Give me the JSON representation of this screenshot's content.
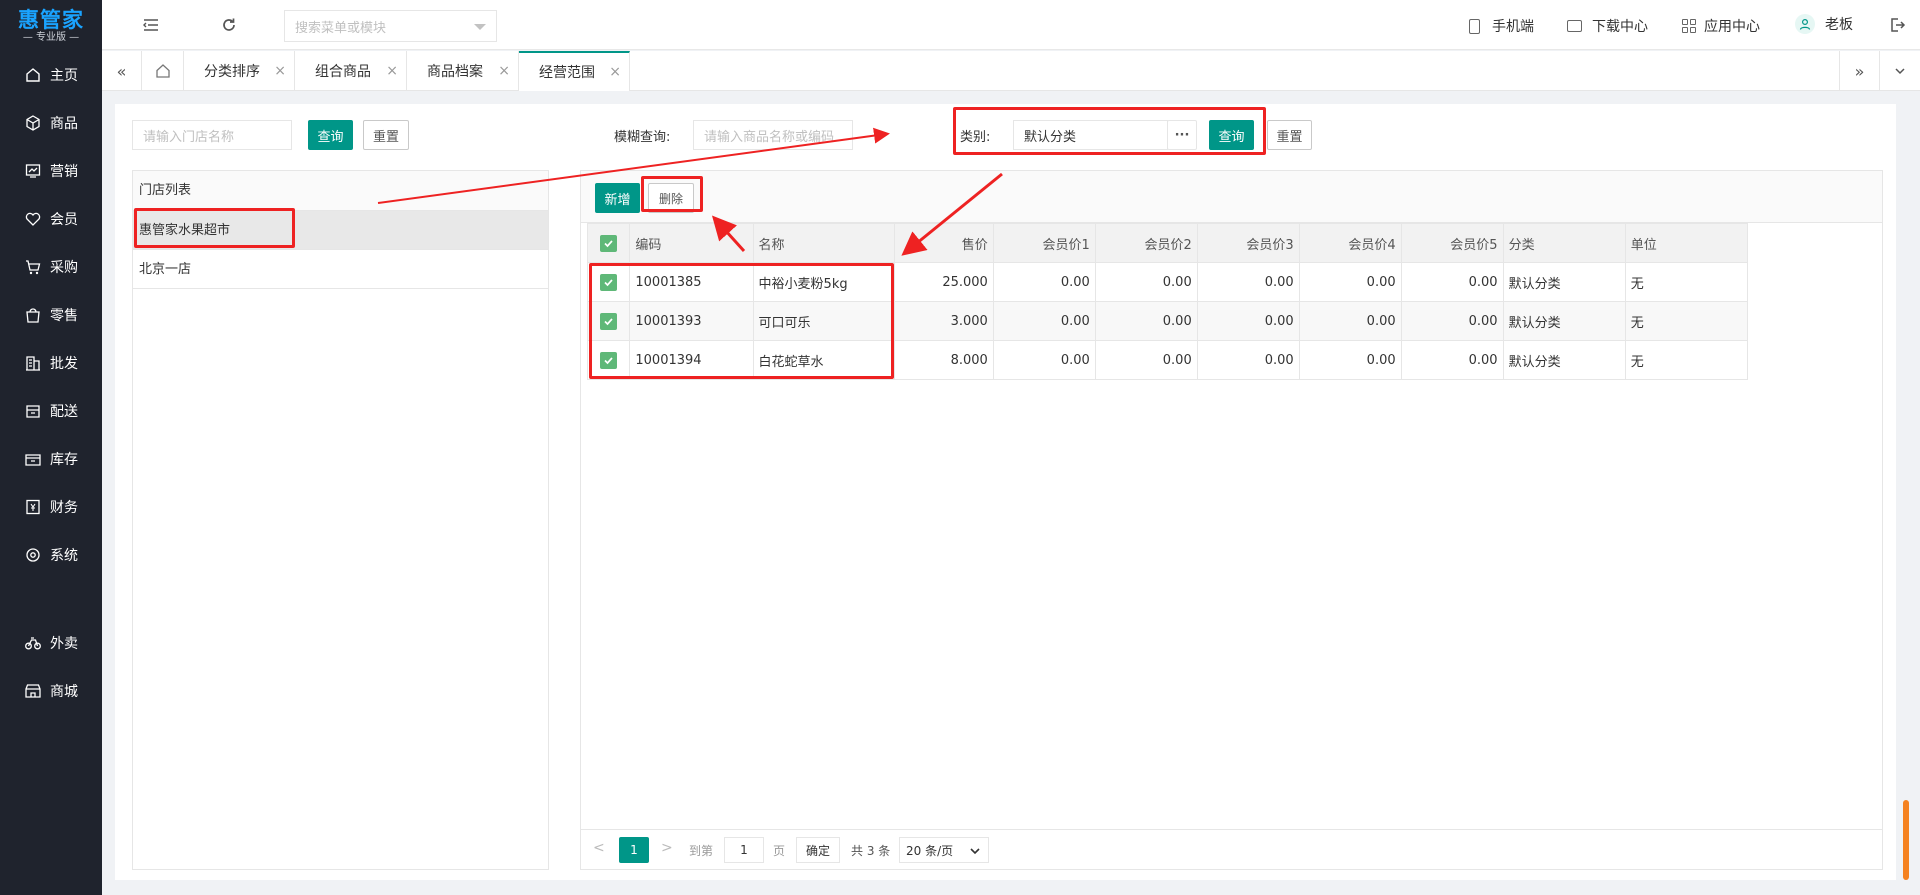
{
  "brand": {
    "title": "惠管家",
    "subtitle": "— 专业版 —"
  },
  "sidebar": {
    "items": [
      {
        "label": "主页",
        "icon": "home-icon"
      },
      {
        "label": "商品",
        "icon": "box-icon"
      },
      {
        "label": "营销",
        "icon": "chart-icon"
      },
      {
        "label": "会员",
        "icon": "heart-icon"
      },
      {
        "label": "采购",
        "icon": "cart-icon"
      },
      {
        "label": "零售",
        "icon": "bag-icon"
      },
      {
        "label": "批发",
        "icon": "building-icon"
      },
      {
        "label": "配送",
        "icon": "store-icon"
      },
      {
        "label": "库存",
        "icon": "inventory-icon"
      },
      {
        "label": "财务",
        "icon": "finance-icon"
      },
      {
        "label": "系统",
        "icon": "settings-icon"
      },
      {
        "label": "外卖",
        "icon": "bike-icon"
      },
      {
        "label": "商城",
        "icon": "shop-icon"
      }
    ]
  },
  "topbar": {
    "search_placeholder": "搜索菜单或模块",
    "mobile_label": "手机端",
    "download_label": "下载中心",
    "apps_label": "应用中心",
    "user_label": "老板"
  },
  "tabs": [
    {
      "label": "分类排序"
    },
    {
      "label": "组合商品"
    },
    {
      "label": "商品档案"
    },
    {
      "label": "经营范围",
      "active": true
    }
  ],
  "filters": {
    "store_placeholder": "请输入门店名称",
    "query_label": "查询",
    "reset_label": "重置",
    "fuzzy_label": "模糊查询:",
    "fuzzy_placeholder": "请输入商品名称或编码",
    "category_label": "类别:",
    "category_value": "默认分类",
    "more_label": "···"
  },
  "store_list": {
    "header": "门店列表",
    "items": [
      "惠管家水果超市",
      "北京一店"
    ]
  },
  "actions": {
    "add_label": "新增",
    "delete_label": "删除"
  },
  "table": {
    "headers": [
      "编码",
      "名称",
      "售价",
      "会员价1",
      "会员价2",
      "会员价3",
      "会员价4",
      "会员价5",
      "分类",
      "单位"
    ],
    "rows": [
      [
        "10001385",
        "中裕小麦粉5kg",
        "25.000",
        "0.00",
        "0.00",
        "0.00",
        "0.00",
        "0.00",
        "默认分类",
        "无"
      ],
      [
        "10001393",
        "可口可乐",
        "3.000",
        "0.00",
        "0.00",
        "0.00",
        "0.00",
        "0.00",
        "默认分类",
        "无"
      ],
      [
        "10001394",
        "白花蛇草水",
        "8.000",
        "0.00",
        "0.00",
        "0.00",
        "0.00",
        "0.00",
        "默认分类",
        "无"
      ]
    ]
  },
  "pagination": {
    "current": "1",
    "goto_label": "到第",
    "page_input": "1",
    "page_unit": "页",
    "confirm_label": "确定",
    "total_label": "共 3 条",
    "page_size": "20 条/页"
  },
  "colors": {
    "accent": "#009688",
    "sidebar_bg": "#1f232d",
    "annotation_red": "#ee2222"
  }
}
